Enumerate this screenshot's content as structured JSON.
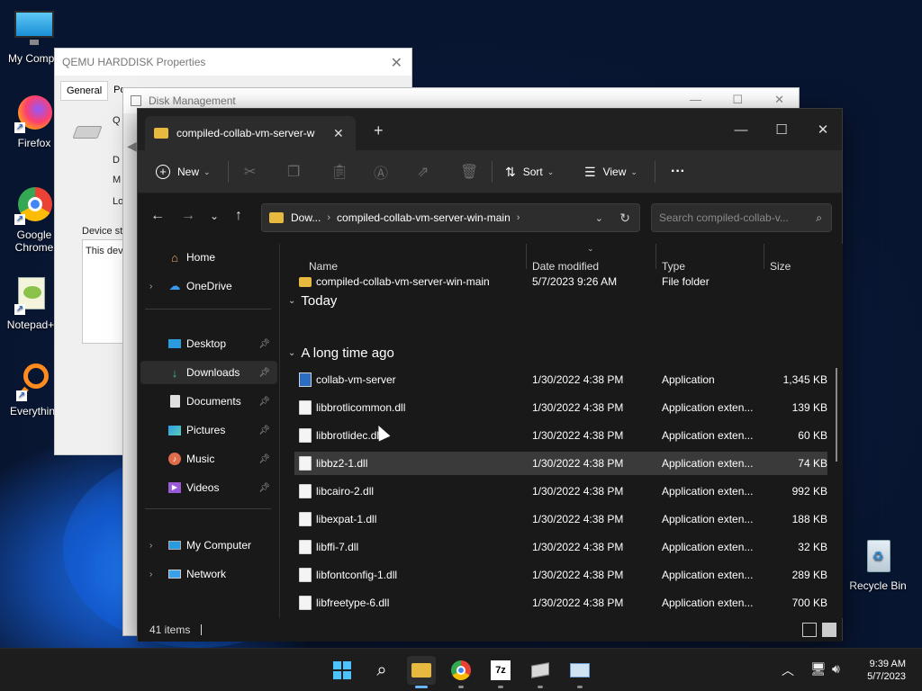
{
  "desktop": {
    "icons": [
      {
        "label": "My Compu",
        "icon": "monitor-icon"
      },
      {
        "label": "Firefox",
        "icon": "firefox-icon"
      },
      {
        "label": "Google Chrome",
        "icon": "chrome-icon"
      },
      {
        "label": "Notepad+",
        "icon": "notepadpp-icon"
      },
      {
        "label": "Everythin",
        "icon": "everything-icon"
      },
      {
        "label": "Recycle Bin",
        "icon": "recycle-bin-icon"
      }
    ]
  },
  "props_window": {
    "title": "QEMU HARDDISK Properties",
    "tab_general": "General",
    "tab_other": "Po",
    "frag_q": "Q",
    "frag_d": "D",
    "frag_m": "M",
    "frag_l": "Lo",
    "device_status": "Device st",
    "device_text": "This devi"
  },
  "disk_window": {
    "title": "Disk Management"
  },
  "explorer": {
    "tab_title": "compiled-collab-vm-server-w",
    "new_tab": "+",
    "toolbar": {
      "new_label": "New",
      "sort_label": "Sort",
      "view_label": "View",
      "more_label": "···"
    },
    "address": {
      "crumb1": "Dow...",
      "crumb2": "compiled-collab-vm-server-win-main"
    },
    "search_placeholder": "Search compiled-collab-v...",
    "nav": {
      "home": "Home",
      "onedrive": "OneDrive",
      "desktop": "Desktop",
      "downloads": "Downloads",
      "documents": "Documents",
      "pictures": "Pictures",
      "music": "Music",
      "videos": "Videos",
      "mycomputer": "My Computer",
      "network": "Network"
    },
    "columns": {
      "name": "Name",
      "date": "Date modified",
      "type": "Type",
      "size": "Size"
    },
    "groups": {
      "today": "Today",
      "older": "A long time ago"
    },
    "today_rows": [
      {
        "name": "compiled-collab-vm-server-win-main",
        "date": "5/7/2023 9:26 AM",
        "type": "File folder",
        "size": ""
      }
    ],
    "older_rows": [
      {
        "name": "collab-vm-server",
        "date": "1/30/2022 4:38 PM",
        "type": "Application",
        "size": "1,345 KB"
      },
      {
        "name": "libbrotlicommon.dll",
        "date": "1/30/2022 4:38 PM",
        "type": "Application exten...",
        "size": "139 KB"
      },
      {
        "name": "libbrotlidec.dll",
        "date": "1/30/2022 4:38 PM",
        "type": "Application exten...",
        "size": "60 KB"
      },
      {
        "name": "libbz2-1.dll",
        "date": "1/30/2022 4:38 PM",
        "type": "Application exten...",
        "size": "74 KB"
      },
      {
        "name": "libcairo-2.dll",
        "date": "1/30/2022 4:38 PM",
        "type": "Application exten...",
        "size": "992 KB"
      },
      {
        "name": "libexpat-1.dll",
        "date": "1/30/2022 4:38 PM",
        "type": "Application exten...",
        "size": "188 KB"
      },
      {
        "name": "libffi-7.dll",
        "date": "1/30/2022 4:38 PM",
        "type": "Application exten...",
        "size": "32 KB"
      },
      {
        "name": "libfontconfig-1.dll",
        "date": "1/30/2022 4:38 PM",
        "type": "Application exten...",
        "size": "289 KB"
      },
      {
        "name": "libfreetype-6.dll",
        "date": "1/30/2022 4:38 PM",
        "type": "Application exten...",
        "size": "700 KB"
      }
    ],
    "status": "41 items"
  },
  "taskbar": {
    "tb_7z": "7z",
    "time": "9:39 AM",
    "date": "5/7/2023"
  },
  "colors": {
    "accent": "#6cb6ff",
    "explorer_bg": "#191919",
    "folder": "#e8b93f"
  }
}
